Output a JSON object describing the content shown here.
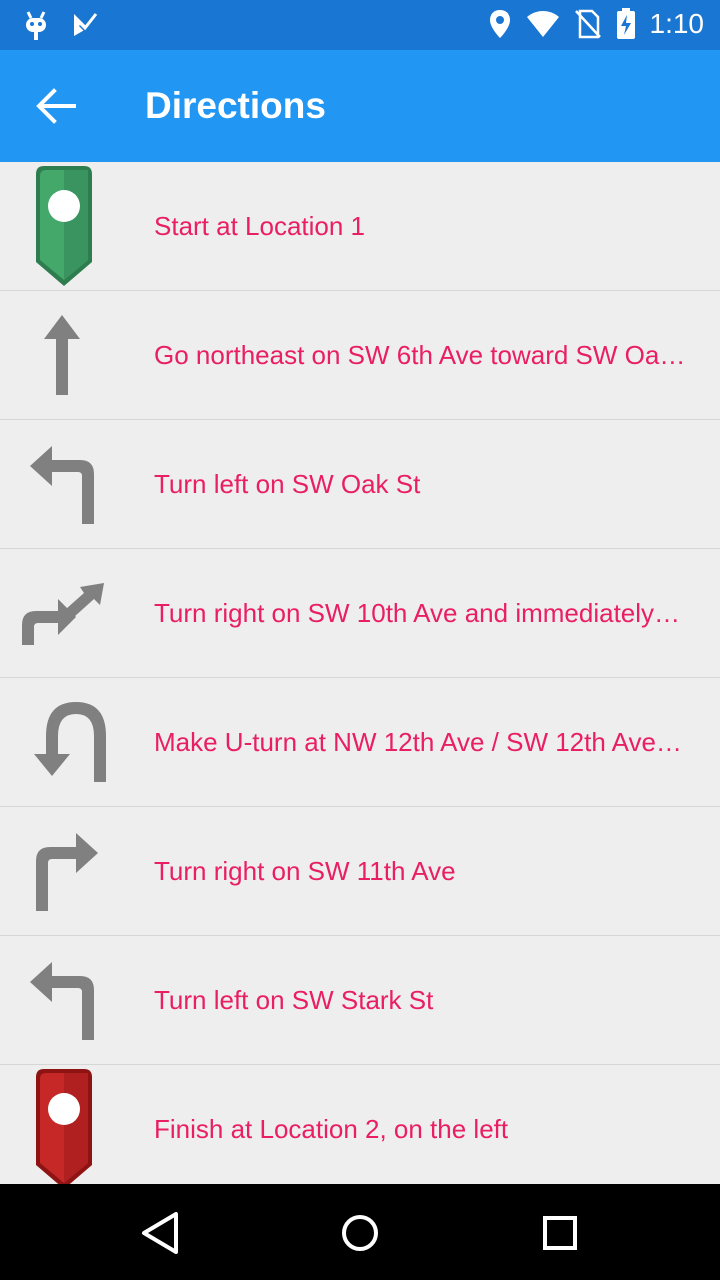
{
  "status_bar": {
    "time": "1:10",
    "icons": [
      "android-debug-icon",
      "check-task-icon",
      "location-icon",
      "wifi-icon",
      "no-sim-icon",
      "battery-charging-icon"
    ]
  },
  "app_bar": {
    "title": "Directions",
    "back_icon": "arrow-back-icon"
  },
  "directions": [
    {
      "icon": "start-pin-icon",
      "text": "Start at Location 1"
    },
    {
      "icon": "straight-arrow-icon",
      "text": "Go northeast on SW 6th Ave toward SW Oa…"
    },
    {
      "icon": "turn-left-icon",
      "text": "Turn left on SW Oak St"
    },
    {
      "icon": "turn-right-then-icon",
      "text": "Turn right on SW 10th Ave and immediately…"
    },
    {
      "icon": "u-turn-icon",
      "text": "Make U-turn at NW 12th Ave / SW 12th Ave…"
    },
    {
      "icon": "turn-right-icon",
      "text": "Turn right on SW 11th Ave"
    },
    {
      "icon": "turn-left-icon",
      "text": "Turn left on SW Stark St"
    },
    {
      "icon": "finish-pin-icon",
      "text": "Finish at Location 2, on the left"
    }
  ],
  "nav_bar": {
    "buttons": [
      "back-triangle-icon",
      "home-circle-icon",
      "recents-square-icon"
    ]
  },
  "colors": {
    "status_bar": "#1976d2",
    "app_bar": "#2196f3",
    "text": "#e91e63",
    "background": "#eeeeee"
  }
}
